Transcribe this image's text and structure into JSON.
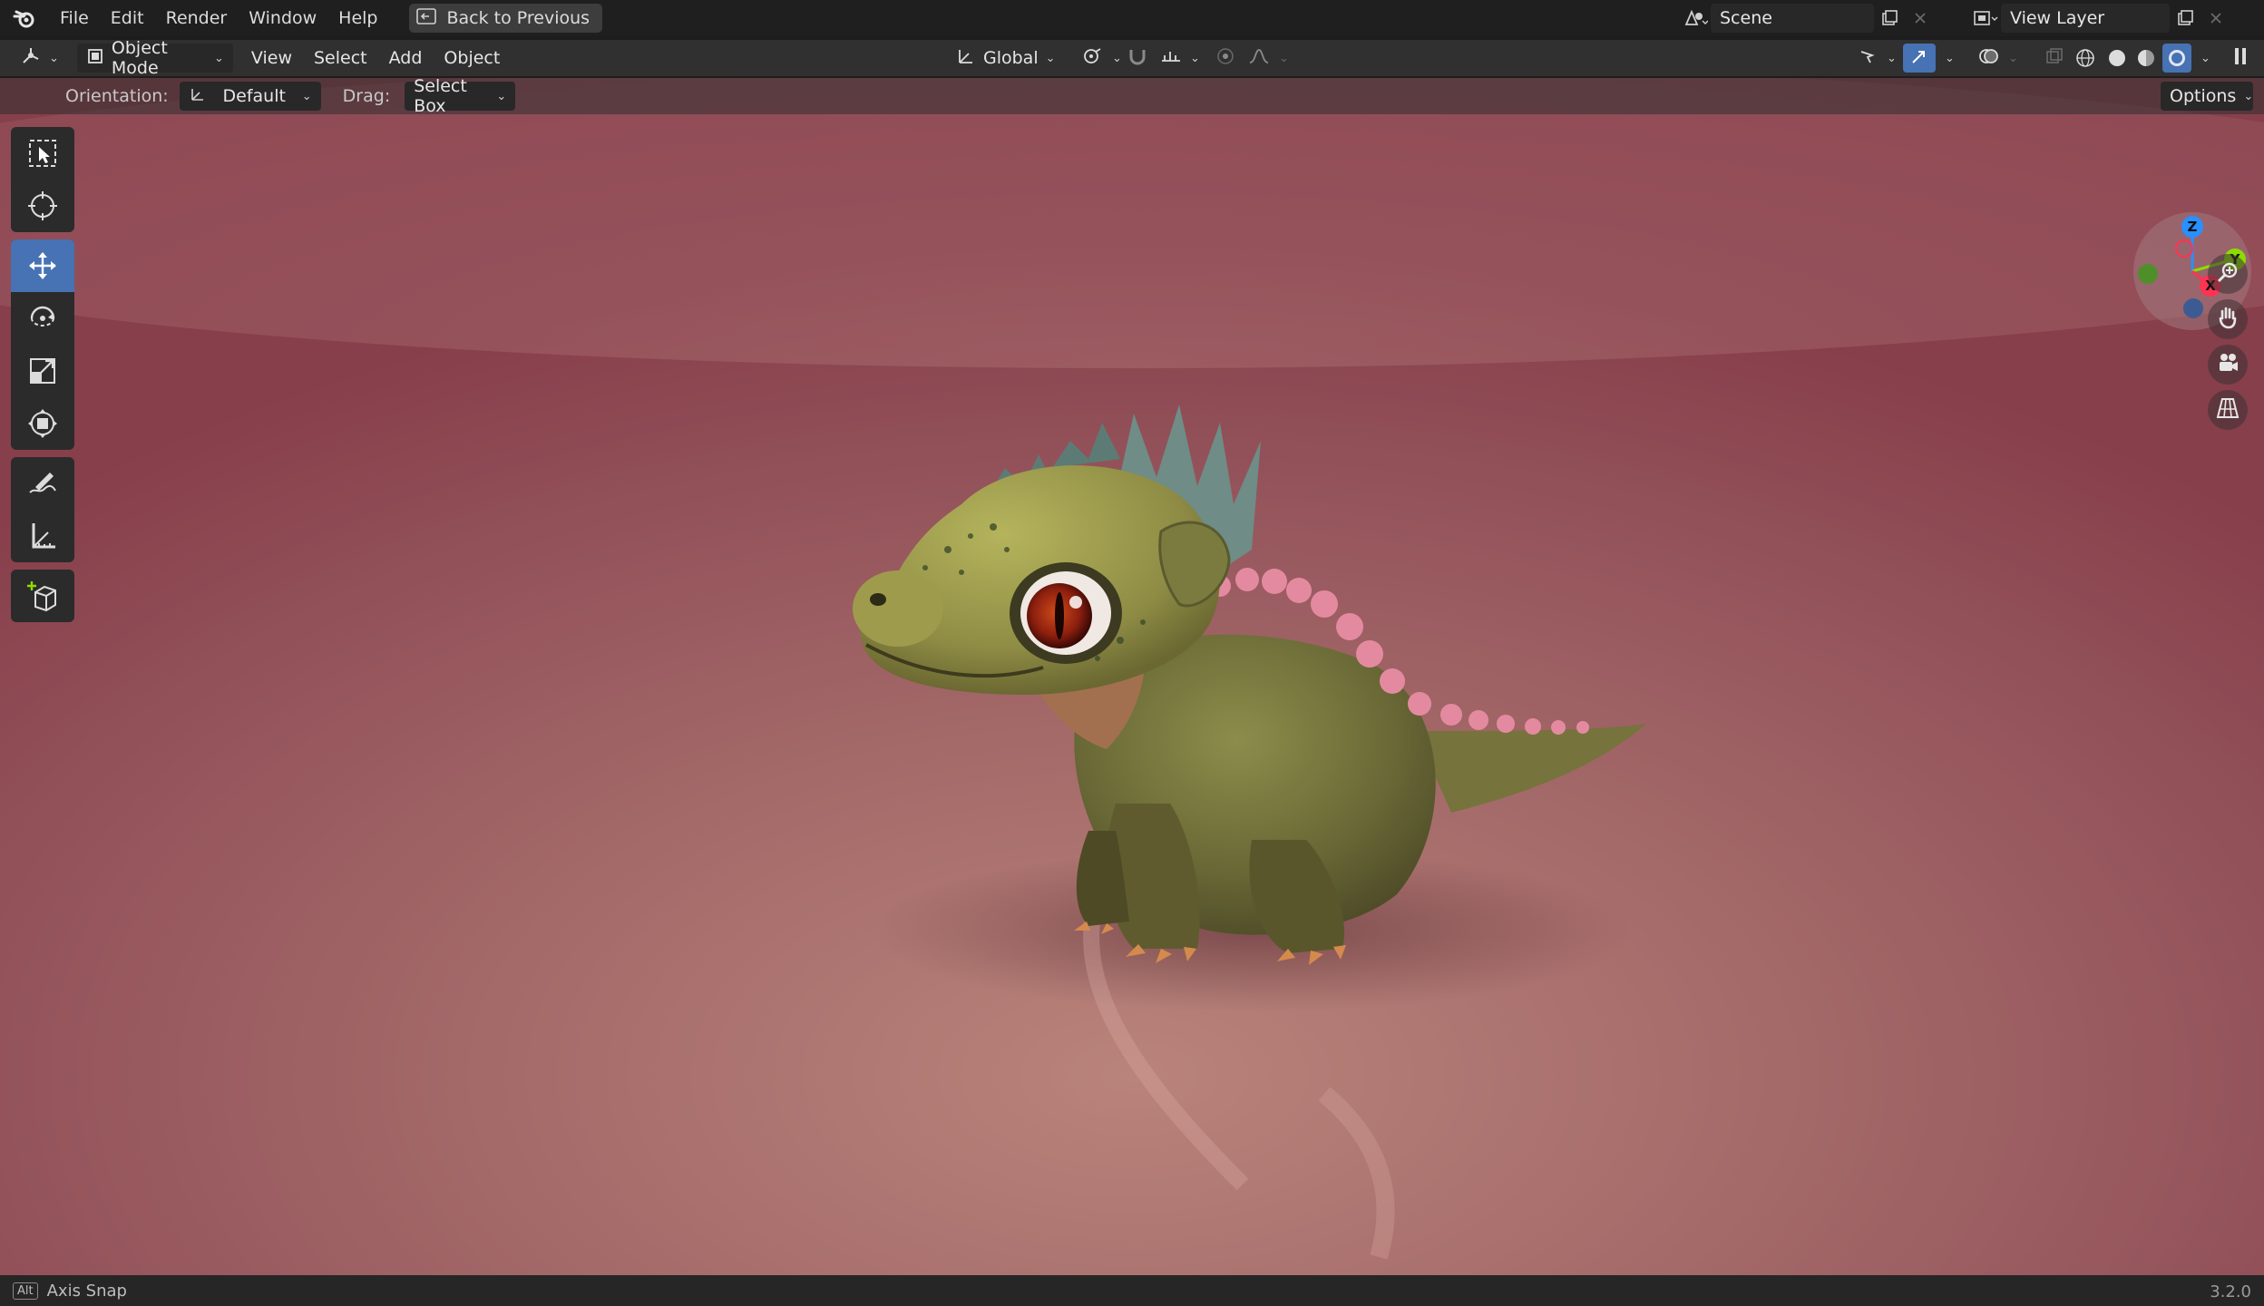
{
  "topbar": {
    "logo_icon": "blender-logo-icon",
    "menus": [
      "File",
      "Edit",
      "Render",
      "Window",
      "Help"
    ],
    "back_button": "Back to Previous",
    "scene": {
      "label": "Scene"
    },
    "view_layer": {
      "label": "View Layer"
    }
  },
  "header": {
    "editor_type_icon": "3d-viewport-icon",
    "mode": "Object Mode",
    "menus": [
      "View",
      "Select",
      "Add",
      "Object"
    ],
    "transform_orientation": "Global",
    "options_label": "Options"
  },
  "tool_settings": {
    "orientation_label": "Orientation:",
    "orientation_value": "Default",
    "drag_label": "Drag:",
    "drag_value": "Select Box"
  },
  "toolbar": {
    "tools": [
      "select-box",
      "cursor",
      "move",
      "rotate",
      "scale",
      "transform",
      "annotate",
      "measure",
      "add-cube"
    ],
    "active": "move"
  },
  "gizmo": {
    "x": "X",
    "y": "Y",
    "z": "Z"
  },
  "statusbar": {
    "key": "Alt",
    "hint": "Axis Snap",
    "version": "3.2.0"
  },
  "colors": {
    "active_tool": "#4772b3",
    "axis_x": "#ff3352",
    "axis_y": "#8bdc00",
    "axis_z": "#2890ff"
  }
}
